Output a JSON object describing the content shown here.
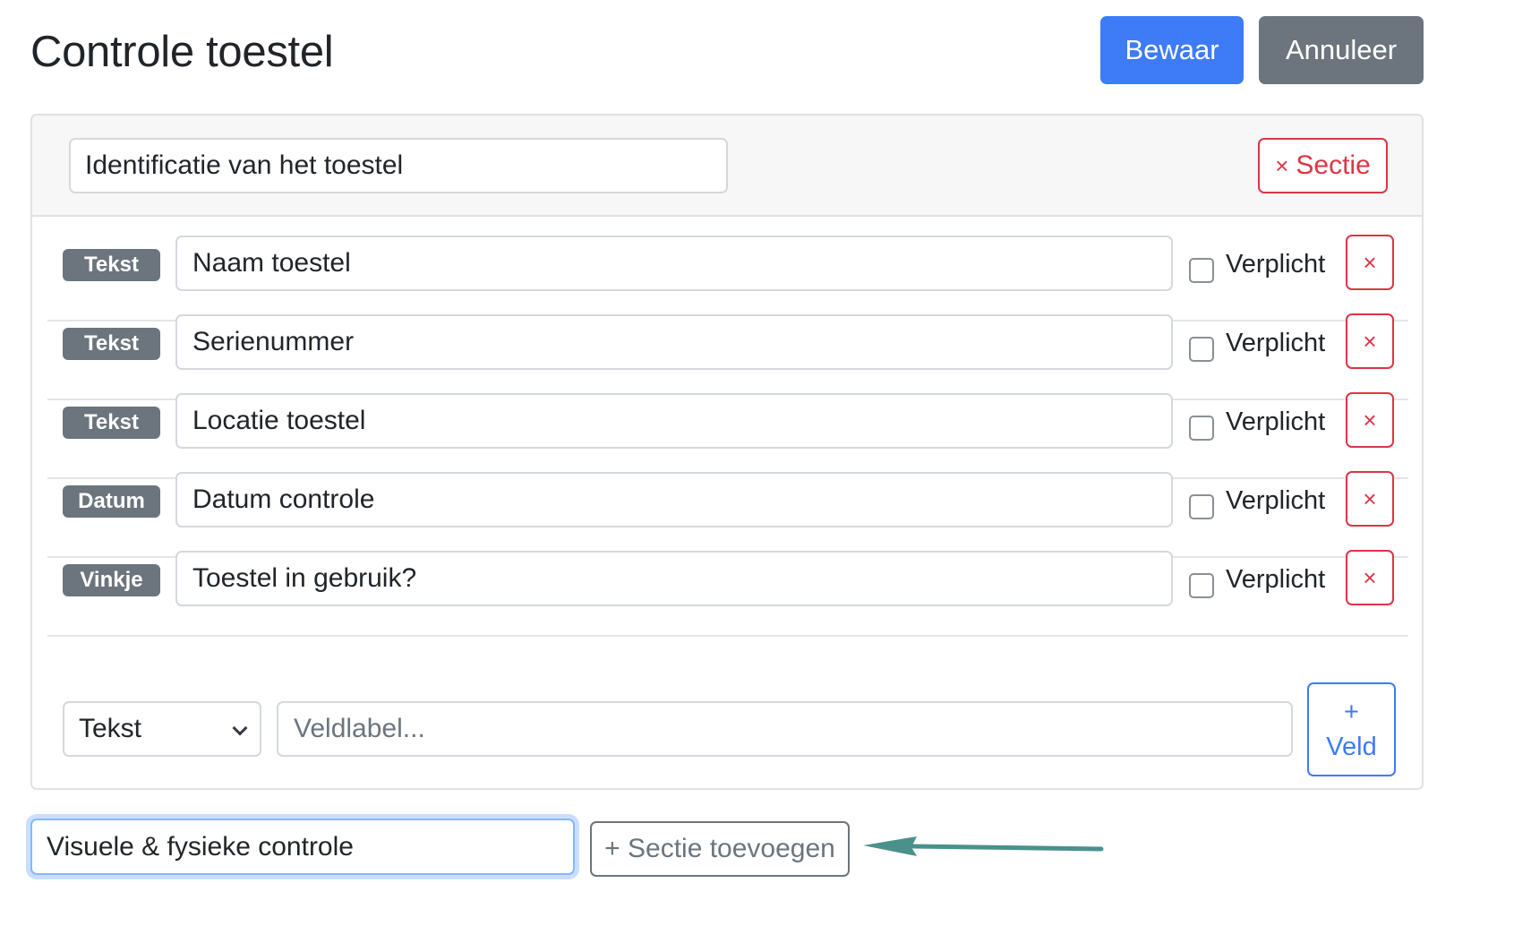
{
  "header": {
    "title": "Controle toestel",
    "save_label": "Bewaar",
    "cancel_label": "Annuleer"
  },
  "section": {
    "title_value": "Identificatie van het toestel",
    "remove_label": "Sectie",
    "remove_icon": "x-icon",
    "fields": [
      {
        "type": "Tekst",
        "label": "Naam toestel",
        "required_label": "Verplicht",
        "required": false
      },
      {
        "type": "Tekst",
        "label": "Serienummer",
        "required_label": "Verplicht",
        "required": false
      },
      {
        "type": "Tekst",
        "label": "Locatie toestel",
        "required_label": "Verplicht",
        "required": false
      },
      {
        "type": "Datum",
        "label": "Datum controle",
        "required_label": "Verplicht",
        "required": false
      },
      {
        "type": "Vinkje",
        "label": "Toestel in gebruik?",
        "required_label": "Verplicht",
        "required": false
      }
    ],
    "remove_field_glyph": "×",
    "new_field": {
      "type_selected": "Tekst",
      "label_placeholder": "Veldlabel...",
      "add_plus": "+",
      "add_label": "Veld"
    }
  },
  "new_section": {
    "input_value": "Visuele & fysieke controle",
    "add_label": "+ Sectie toevoegen"
  },
  "colors": {
    "primary": "#3d7bf7",
    "secondary": "#6c757d",
    "danger": "#dc3545",
    "annotation_arrow": "#4a918c"
  }
}
